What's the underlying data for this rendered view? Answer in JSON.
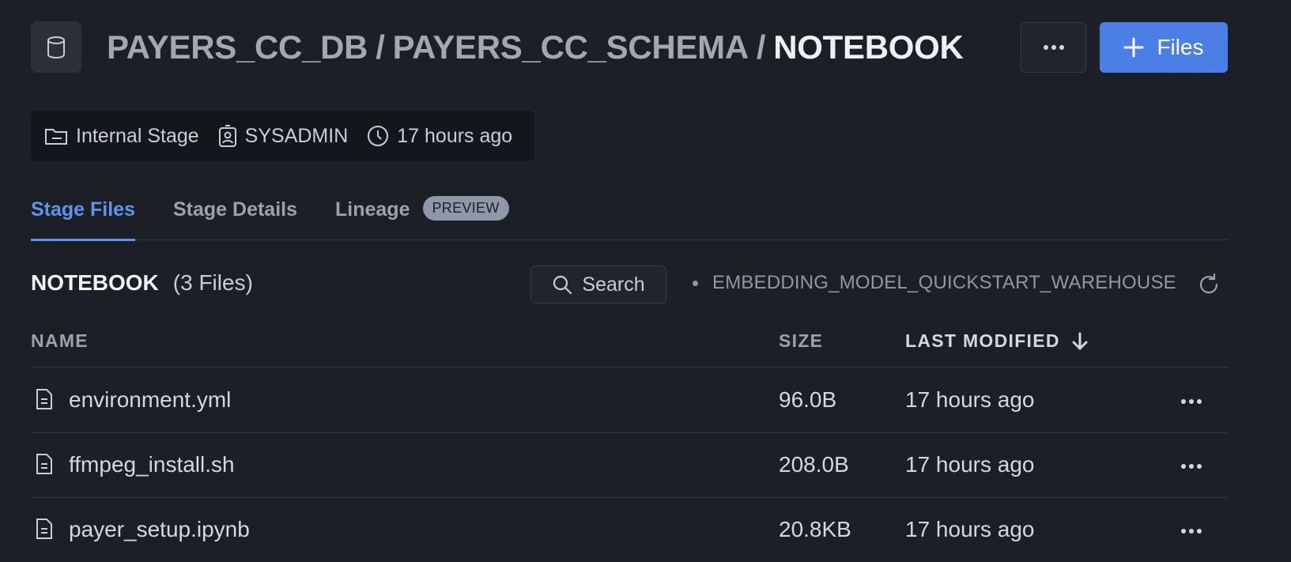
{
  "header": {
    "breadcrumb": [
      "PAYERS_CC_DB",
      "PAYERS_CC_SCHEMA",
      "NOTEBOOK"
    ],
    "separator": "/",
    "files_button_label": "Files"
  },
  "meta": {
    "stage_type": "Internal Stage",
    "owner": "SYSADMIN",
    "created": "17 hours ago"
  },
  "tabs": [
    {
      "label": "Stage Files",
      "active": true
    },
    {
      "label": "Stage Details",
      "active": false
    },
    {
      "label": "Lineage",
      "active": false,
      "badge": "PREVIEW"
    }
  ],
  "section": {
    "name": "NOTEBOOK",
    "count": "(3 Files)",
    "search_label": "Search",
    "warehouse": "EMBEDDING_MODEL_QUICKSTART_WAREHOUSE"
  },
  "table": {
    "columns": {
      "name": "NAME",
      "size": "SIZE",
      "modified": "LAST MODIFIED"
    },
    "rows": [
      {
        "name": "environment.yml",
        "size": "96.0B",
        "modified": "17 hours ago"
      },
      {
        "name": "ffmpeg_install.sh",
        "size": "208.0B",
        "modified": "17 hours ago"
      },
      {
        "name": "payer_setup.ipynb",
        "size": "20.8KB",
        "modified": "17 hours ago"
      }
    ]
  },
  "colors": {
    "background": "#1c1f25",
    "accent": "#4b7fe6",
    "active_tab": "#5f93ee"
  }
}
